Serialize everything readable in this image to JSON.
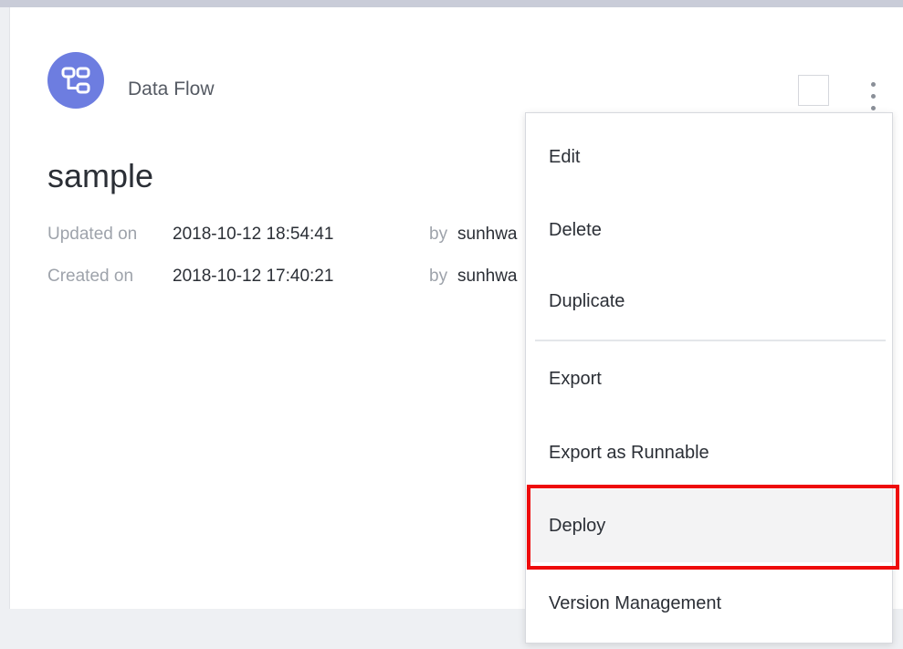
{
  "card": {
    "type_label": "Data Flow",
    "title": "sample",
    "icon": "data-flow-icon",
    "accent_color": "#6d7de0",
    "meta": [
      {
        "key": "Updated on",
        "value": "2018-10-12 18:54:41",
        "by": "by",
        "user": "sunhwa"
      },
      {
        "key": "Created on",
        "value": "2018-10-12 17:40:21",
        "by": "by",
        "user": "sunhwa"
      }
    ]
  },
  "menu": {
    "items": [
      {
        "label": "Edit"
      },
      {
        "label": "Delete"
      },
      {
        "label": "Duplicate"
      },
      {
        "label": "Export"
      },
      {
        "label": "Export as Runnable"
      },
      {
        "label": "Deploy",
        "highlighted": true
      },
      {
        "label": "Version Management"
      }
    ]
  },
  "annotation": {
    "highlight_color": "#ee0b0b",
    "highlighted_item": "Deploy"
  }
}
